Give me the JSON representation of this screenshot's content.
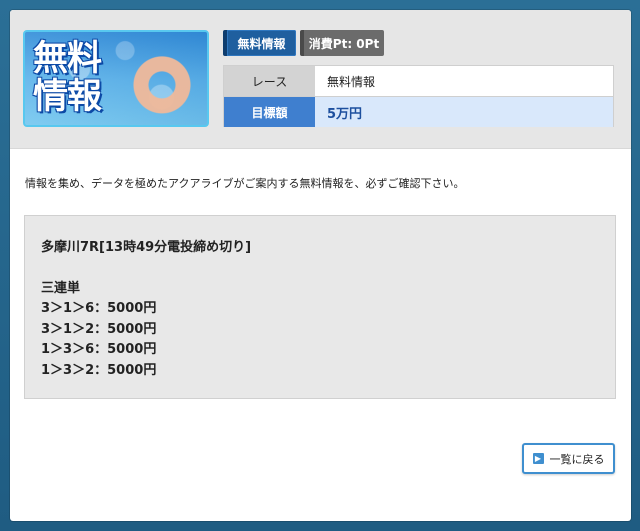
{
  "banner": {
    "title": "無料\n情報"
  },
  "tabs": {
    "free_label": "無料情報",
    "cost_label": "消費Pt: 0Pt"
  },
  "info": {
    "race_label": "レース",
    "race_value": "無料情報",
    "target_label": "目標額",
    "target_value": "5万円"
  },
  "intro_text": "情報を集め、データを極めたアクアライブがご案内する無料情報を、必ずご確認下さい。",
  "content": {
    "race_head": "多摩川7R[13時49分電投締め切り]",
    "bet_type": "三連単",
    "bets": [
      "3＞1＞6：5000円",
      "3＞1＞2：5000円",
      "1＞3＞6：5000円",
      "1＞3＞2：5000円"
    ]
  },
  "back_button_label": "一覧に戻る",
  "colors": {
    "accent_blue": "#3f7fcf",
    "tab_dark_blue": "#1f5f9f",
    "target_bg": "#d9e8fb"
  }
}
